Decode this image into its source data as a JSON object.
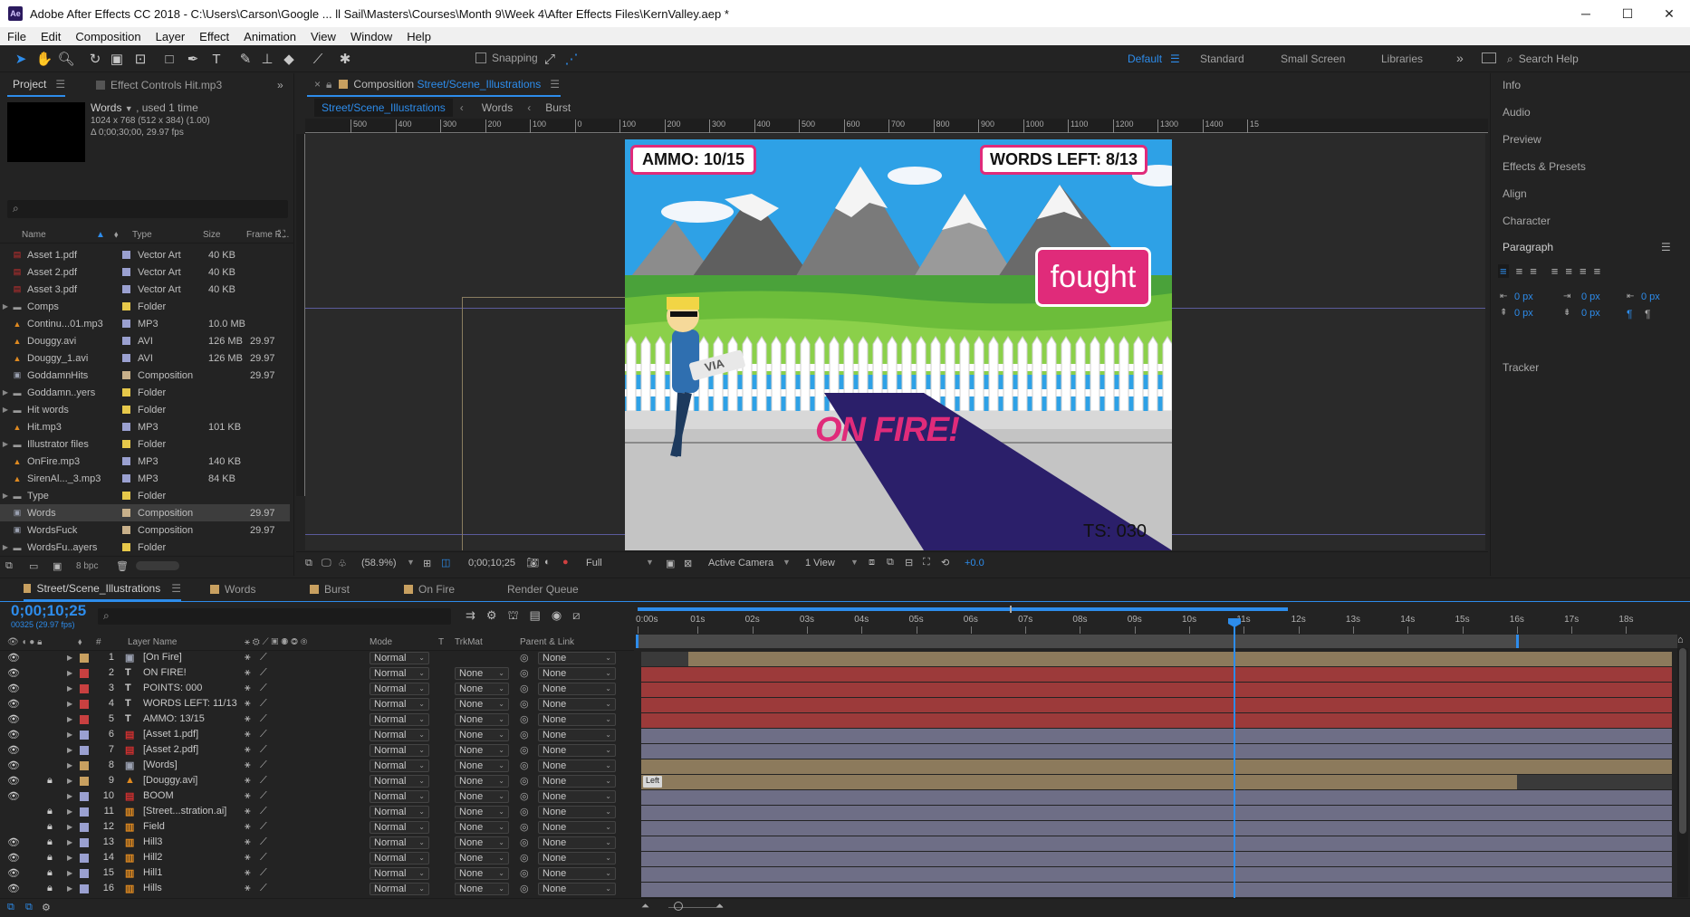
{
  "window": {
    "app_badge": "Ae",
    "title": "Adobe After Effects CC 2018 - C:\\Users\\Carson\\Google ... ll Sail\\Masters\\Courses\\Month 9\\Week 4\\After Effects Files\\KernValley.aep *"
  },
  "menu": [
    "File",
    "Edit",
    "Composition",
    "Layer",
    "Effect",
    "Animation",
    "View",
    "Window",
    "Help"
  ],
  "toolbar": {
    "snapping_label": "Snapping",
    "workspaces": [
      "Default",
      "Standard",
      "Small Screen",
      "Libraries"
    ],
    "active_workspace": "Default",
    "search_placeholder": "Search Help"
  },
  "project_panel": {
    "tab_project": "Project",
    "tab_effect_controls": "Effect Controls Hit.mp3",
    "selected_item": "Words",
    "used_text": ", used 1 time",
    "info_line1": "1024 x 768  (512 x 384) (1.00)",
    "info_line2": "Δ 0;00;30;00, 29.97 fps",
    "columns": [
      "Name",
      "Type",
      "Size",
      "Frame R..."
    ],
    "items": [
      {
        "name": "Asset 1.pdf",
        "type": "Vector Art",
        "size": "40 KB",
        "fr": "",
        "icon": "pdf",
        "folder": false,
        "color": "#9aa0d0"
      },
      {
        "name": "Asset 2.pdf",
        "type": "Vector Art",
        "size": "40 KB",
        "fr": "",
        "icon": "pdf",
        "folder": false,
        "color": "#9aa0d0"
      },
      {
        "name": "Asset 3.pdf",
        "type": "Vector Art",
        "size": "40 KB",
        "fr": "",
        "icon": "pdf",
        "folder": false,
        "color": "#9aa0d0"
      },
      {
        "name": "Comps",
        "type": "Folder",
        "size": "",
        "fr": "",
        "icon": "folder",
        "folder": true,
        "color": "#e6c84a"
      },
      {
        "name": "Continu...01.mp3",
        "type": "MP3",
        "size": "10.0 MB",
        "fr": "",
        "icon": "audio",
        "folder": false,
        "color": "#9aa0d0"
      },
      {
        "name": "Douggy.avi",
        "type": "AVI",
        "size": "126 MB",
        "fr": "29.97",
        "icon": "audio",
        "folder": false,
        "color": "#9aa0d0"
      },
      {
        "name": "Douggy_1.avi",
        "type": "AVI",
        "size": "126 MB",
        "fr": "29.97",
        "icon": "audio",
        "folder": false,
        "color": "#9aa0d0"
      },
      {
        "name": "GoddamnHits",
        "type": "Composition",
        "size": "",
        "fr": "29.97",
        "icon": "comp",
        "folder": false,
        "color": "#c8b08a"
      },
      {
        "name": "Goddamn..yers",
        "type": "Folder",
        "size": "",
        "fr": "",
        "icon": "folder",
        "folder": true,
        "color": "#e6c84a"
      },
      {
        "name": "Hit words",
        "type": "Folder",
        "size": "",
        "fr": "",
        "icon": "folder",
        "folder": true,
        "color": "#e6c84a"
      },
      {
        "name": "Hit.mp3",
        "type": "MP3",
        "size": "101 KB",
        "fr": "",
        "icon": "audio",
        "folder": false,
        "color": "#9aa0d0"
      },
      {
        "name": "Illustrator files",
        "type": "Folder",
        "size": "",
        "fr": "",
        "icon": "folder",
        "folder": true,
        "color": "#e6c84a"
      },
      {
        "name": "OnFire.mp3",
        "type": "MP3",
        "size": "140 KB",
        "fr": "",
        "icon": "audio",
        "folder": false,
        "color": "#9aa0d0"
      },
      {
        "name": "SirenAl..._3.mp3",
        "type": "MP3",
        "size": "84 KB",
        "fr": "",
        "icon": "audio",
        "folder": false,
        "color": "#9aa0d0"
      },
      {
        "name": "Type",
        "type": "Folder",
        "size": "",
        "fr": "",
        "icon": "folder",
        "folder": true,
        "color": "#e6c84a"
      },
      {
        "name": "Words",
        "type": "Composition",
        "size": "",
        "fr": "29.97",
        "icon": "comp",
        "folder": false,
        "color": "#c8b08a"
      },
      {
        "name": "WordsFuck",
        "type": "Composition",
        "size": "",
        "fr": "29.97",
        "icon": "comp",
        "folder": false,
        "color": "#c8b08a"
      },
      {
        "name": "WordsFu..ayers",
        "type": "Folder",
        "size": "",
        "fr": "",
        "icon": "folder",
        "folder": true,
        "color": "#e6c84a"
      }
    ],
    "bpc": "8 bpc"
  },
  "composition_panel": {
    "tab_prefix": "Composition",
    "tab_comp_name": "Street/Scene_Illustrations",
    "breadcrumbs": [
      "Street/Scene_Illustrations",
      "Words",
      "Burst"
    ],
    "ruler_labels": [
      "500",
      "400",
      "300",
      "200",
      "100",
      "0",
      "100",
      "200",
      "300",
      "400",
      "500",
      "600",
      "700",
      "800",
      "900",
      "1000",
      "1100",
      "1200",
      "1300",
      "1400",
      "15"
    ],
    "zoom": "(58.9%)",
    "timecode": "0;00;10;25",
    "resolution": "Full",
    "camera": "Active Camera",
    "views": "1 View",
    "exposure": "+0.0"
  },
  "scene": {
    "ammo": "AMMO: 10/15",
    "words_left": "WORDS LEFT: 8/13",
    "word": "fought",
    "on_fire": "ON FIRE!",
    "points": "TS: 030",
    "sign": "VIA"
  },
  "right_panel": {
    "items": [
      "Info",
      "Audio",
      "Preview",
      "Effects & Presets",
      "Align",
      "Character"
    ],
    "paragraph_title": "Paragraph",
    "px_values": [
      "0 px",
      "0 px",
      "0 px",
      "0 px",
      "0 px"
    ],
    "tracker": "Tracker"
  },
  "timeline": {
    "tabs": [
      "Street/Scene_Illustrations",
      "Words",
      "Burst",
      "On Fire",
      "Render Queue"
    ],
    "timecode": "0;00;10;25",
    "frame_info": "00325 (29.97 fps)",
    "col_headers": {
      "name": "Layer Name",
      "num": "#",
      "mode": "Mode",
      "t": "T",
      "trkmat": "TrkMat",
      "parent": "Parent & Link"
    },
    "time_labels": [
      "0:00s",
      "01s",
      "02s",
      "03s",
      "04s",
      "05s",
      "06s",
      "07s",
      "08s",
      "09s",
      "10s",
      "11s",
      "12s",
      "13s",
      "14s",
      "15s",
      "16s",
      "17s",
      "18s"
    ],
    "marker_label": "Left",
    "layers": [
      {
        "num": "1",
        "name": "[On Fire]",
        "icon": "comp",
        "color": "#c8a060",
        "mode": "Normal",
        "trk": "",
        "parent": "None",
        "bar": "tan",
        "locked": false,
        "eye": true
      },
      {
        "num": "2",
        "name": "ON FIRE!",
        "icon": "T",
        "color": "#c84040",
        "mode": "Normal",
        "trk": "None",
        "parent": "None",
        "bar": "red",
        "locked": false,
        "eye": true
      },
      {
        "num": "3",
        "name": "POINTS: 000",
        "icon": "T",
        "color": "#c84040",
        "mode": "Normal",
        "trk": "None",
        "parent": "None",
        "bar": "red",
        "locked": false,
        "eye": true
      },
      {
        "num": "4",
        "name": "WORDS LEFT: 11/13",
        "icon": "T",
        "color": "#c84040",
        "mode": "Normal",
        "trk": "None",
        "parent": "None",
        "bar": "red",
        "locked": false,
        "eye": true
      },
      {
        "num": "5",
        "name": "AMMO: 13/15",
        "icon": "T",
        "color": "#c84040",
        "mode": "Normal",
        "trk": "None",
        "parent": "None",
        "bar": "red",
        "locked": false,
        "eye": true
      },
      {
        "num": "6",
        "name": "[Asset 1.pdf]",
        "icon": "pdf",
        "color": "#9aa0d0",
        "mode": "Normal",
        "trk": "None",
        "parent": "None",
        "bar": "blue",
        "locked": false,
        "eye": true
      },
      {
        "num": "7",
        "name": "[Asset 2.pdf]",
        "icon": "pdf",
        "color": "#9aa0d0",
        "mode": "Normal",
        "trk": "None",
        "parent": "None",
        "bar": "blue",
        "locked": false,
        "eye": true
      },
      {
        "num": "8",
        "name": "[Words]",
        "icon": "comp",
        "color": "#c8a060",
        "mode": "Normal",
        "trk": "None",
        "parent": "None",
        "bar": "tan",
        "locked": false,
        "eye": true
      },
      {
        "num": "9",
        "name": "[Douggy.avi]",
        "icon": "audio",
        "color": "#c8a060",
        "mode": "Normal",
        "trk": "None",
        "parent": "None",
        "bar": "tan",
        "locked": true,
        "eye": true
      },
      {
        "num": "10",
        "name": "BOOM",
        "icon": "pdf",
        "color": "#9aa0d0",
        "mode": "Normal",
        "trk": "None",
        "parent": "None",
        "bar": "blue",
        "locked": false,
        "eye": true
      },
      {
        "num": "11",
        "name": "[Street...stration.ai]",
        "icon": "ai",
        "color": "#9aa0d0",
        "mode": "Normal",
        "trk": "None",
        "parent": "None",
        "bar": "blue",
        "locked": true,
        "eye": false
      },
      {
        "num": "12",
        "name": "Field",
        "icon": "ai",
        "color": "#9aa0d0",
        "mode": "Normal",
        "trk": "None",
        "parent": "None",
        "bar": "blue",
        "locked": true,
        "eye": false
      },
      {
        "num": "13",
        "name": "Hill3",
        "icon": "ai",
        "color": "#9aa0d0",
        "mode": "Normal",
        "trk": "None",
        "parent": "None",
        "bar": "blue",
        "locked": true,
        "eye": true
      },
      {
        "num": "14",
        "name": "Hill2",
        "icon": "ai",
        "color": "#9aa0d0",
        "mode": "Normal",
        "trk": "None",
        "parent": "None",
        "bar": "blue",
        "locked": true,
        "eye": true
      },
      {
        "num": "15",
        "name": "Hill1",
        "icon": "ai",
        "color": "#9aa0d0",
        "mode": "Normal",
        "trk": "None",
        "parent": "None",
        "bar": "blue",
        "locked": true,
        "eye": true
      },
      {
        "num": "16",
        "name": "Hills",
        "icon": "ai",
        "color": "#9aa0d0",
        "mode": "Normal",
        "trk": "None",
        "parent": "None",
        "bar": "blue",
        "locked": true,
        "eye": true
      }
    ]
  },
  "colors": {
    "accent": "#2d8ceb",
    "bar_red": "#9c3a3a",
    "bar_tan": "#8c7a5c",
    "bar_blue": "#6e6e86",
    "word_badge": "#e02b7a"
  }
}
